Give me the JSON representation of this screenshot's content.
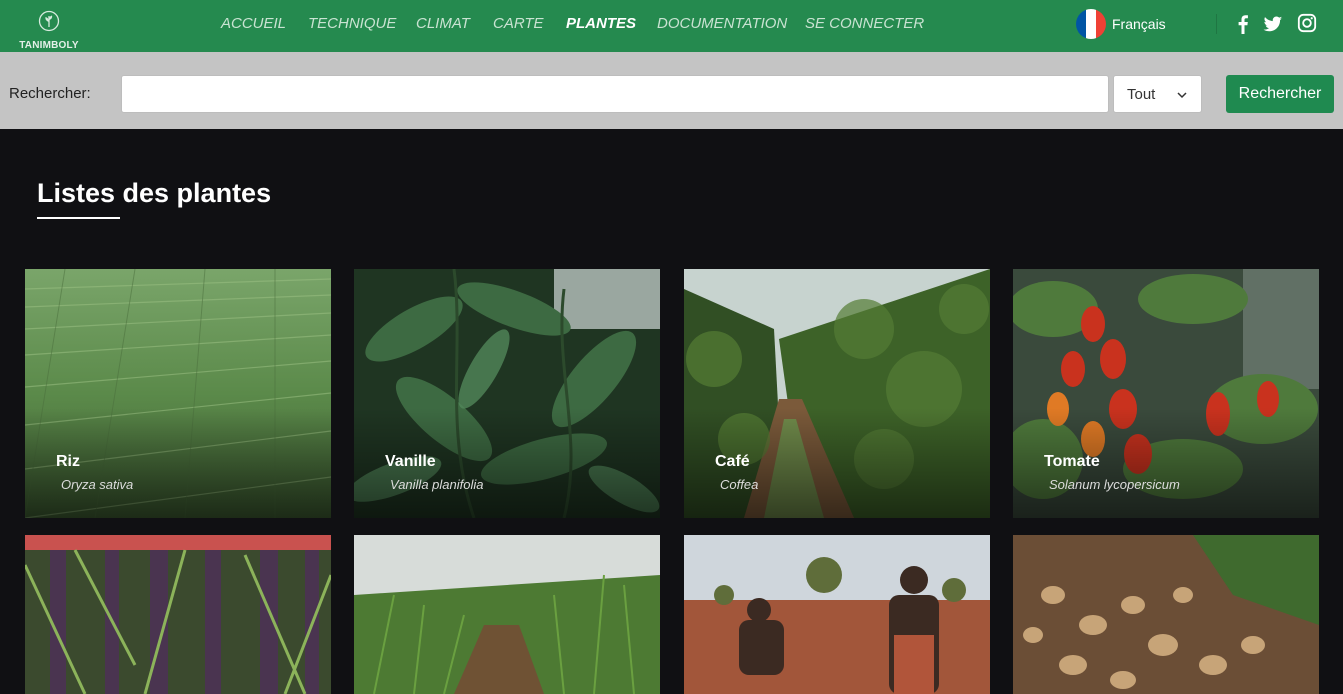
{
  "brand": {
    "name": "TANIMBOLY"
  },
  "nav": {
    "items": [
      {
        "label": "ACCUEIL",
        "active": false
      },
      {
        "label": "TECHNIQUE",
        "active": false
      },
      {
        "label": "CLIMAT",
        "active": false
      },
      {
        "label": "CARTE",
        "active": false
      },
      {
        "label": "PLANTES",
        "active": true
      },
      {
        "label": "DOCUMENTATION",
        "active": false
      },
      {
        "label": "SE CONNECTER",
        "active": false
      }
    ],
    "language": {
      "label": "Français",
      "flag_colors": [
        "#0055a4",
        "#ffffff",
        "#ef4135"
      ]
    },
    "social": [
      {
        "icon": "facebook-icon"
      },
      {
        "icon": "twitter-icon"
      },
      {
        "icon": "instagram-icon"
      }
    ]
  },
  "search": {
    "label": "Rechercher:",
    "value": "",
    "placeholder": "",
    "filter": {
      "selected": "Tout"
    },
    "button_label": "Rechercher"
  },
  "main": {
    "title": "Listes des plantes",
    "plants": [
      {
        "name": "Riz",
        "scientific": "Oryza sativa",
        "image": "rice-paddy-photo"
      },
      {
        "name": "Vanille",
        "scientific": "Vanilla planifolia",
        "image": "vanilla-vine-photo"
      },
      {
        "name": "Café",
        "scientific": "Coffea",
        "image": "coffee-plantation-photo"
      },
      {
        "name": "Tomate",
        "scientific": "Solanum lycopersicum",
        "image": "tomato-plant-photo"
      },
      {
        "name": "",
        "scientific": "",
        "image": "sugarcane-photo"
      },
      {
        "name": "",
        "scientific": "",
        "image": "maize-field-photo"
      },
      {
        "name": "",
        "scientific": "",
        "image": "farmers-planting-photo"
      },
      {
        "name": "",
        "scientific": "",
        "image": "potato-harvest-photo"
      }
    ]
  },
  "colors": {
    "navbar": "#258a4f",
    "accent": "#1f8a50",
    "background": "#101013",
    "searchbar": "#c4c4c4"
  }
}
